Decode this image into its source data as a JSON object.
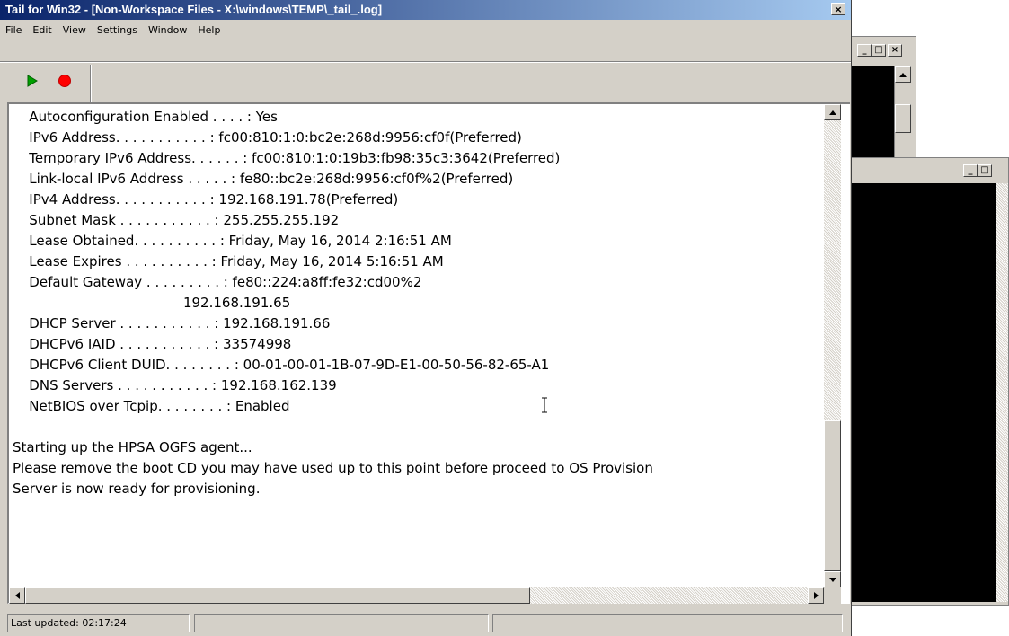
{
  "window": {
    "title": "Tail for Win32 - [Non-Workspace Files - X:\\windows\\TEMP\\_tail_.log]",
    "close_glyph": "×"
  },
  "menu": [
    "File",
    "Edit",
    "View",
    "Settings",
    "Window",
    "Help"
  ],
  "toolbar": {
    "play_icon": "play-icon",
    "stop_icon": "stop-icon"
  },
  "log": {
    "lines": [
      "   Autoconfiguration Enabled . . . . : Yes",
      "   IPv6 Address. . . . . . . . . . . : fc00:810:1:0:bc2e:268d:9956:cf0f(Preferred)",
      "   Temporary IPv6 Address. . . . . . : fc00:810:1:0:19b3:fb98:35c3:3642(Preferred)",
      "   Link-local IPv6 Address . . . . . : fe80::bc2e:268d:9956:cf0f%2(Preferred)",
      "   IPv4 Address. . . . . . . . . . . : 192.168.191.78(Preferred)",
      "   Subnet Mask . . . . . . . . . . . : 255.255.255.192",
      "   Lease Obtained. . . . . . . . . . : Friday, May 16, 2014 2:16:51 AM",
      "   Lease Expires . . . . . . . . . . : Friday, May 16, 2014 5:16:51 AM",
      "   Default Gateway . . . . . . . . . : fe80::224:a8ff:fe32:cd00%2",
      "                                       192.168.191.65",
      "   DHCP Server . . . . . . . . . . . : 192.168.191.66",
      "   DHCPv6 IAID . . . . . . . . . . . : 33574998",
      "   DHCPv6 Client DUID. . . . . . . . : 00-01-00-01-1B-07-9D-E1-00-50-56-82-65-A1",
      "   DNS Servers . . . . . . . . . . . : 192.168.162.139",
      "   NetBIOS over Tcpip. . . . . . . . : Enabled",
      "",
      "Starting up the HPSA OGFS agent...",
      "Please remove the boot CD you may have used up to this point before proceed to OS Provision",
      "Server is now ready for provisioning."
    ]
  },
  "status": {
    "last_updated": "Last updated: 02:17:24"
  },
  "background_windows": {
    "win1_buttons": [
      "_",
      "□",
      "×"
    ],
    "win2_buttons": [
      "_",
      "□"
    ]
  }
}
